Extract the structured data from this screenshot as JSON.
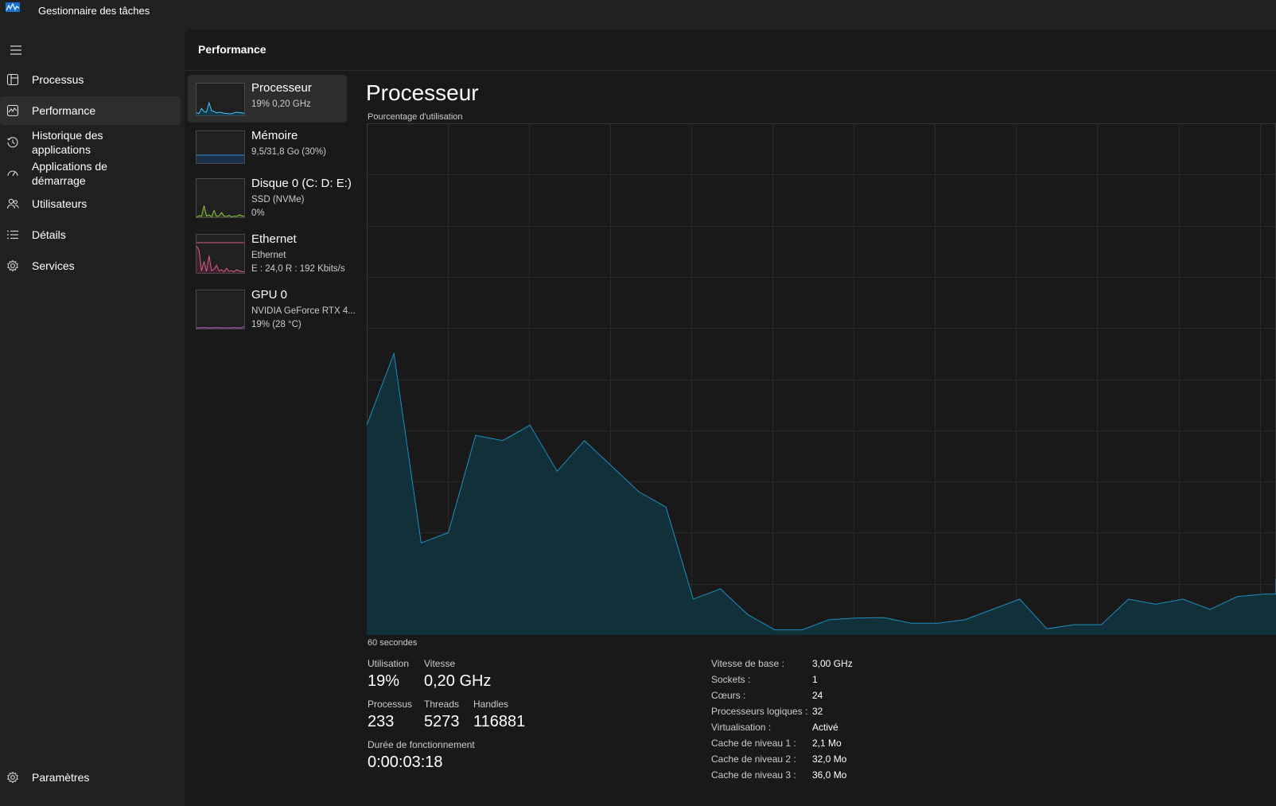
{
  "window": {
    "title": "Gestionnaire des tâches"
  },
  "nav": {
    "items": [
      {
        "label": "Processus",
        "icon": "processes-icon"
      },
      {
        "label": "Performance",
        "icon": "performance-icon",
        "active": true
      },
      {
        "label": "Historique des applications",
        "icon": "history-icon"
      },
      {
        "label": "Applications de démarrage",
        "icon": "startup-icon"
      },
      {
        "label": "Utilisateurs",
        "icon": "users-icon"
      },
      {
        "label": "Détails",
        "icon": "details-icon"
      },
      {
        "label": "Services",
        "icon": "services-icon"
      }
    ],
    "settings": {
      "label": "Paramètres",
      "icon": "gear-icon"
    }
  },
  "header": {
    "title": "Performance"
  },
  "devices": [
    {
      "name": "Processeur",
      "line1": "19%  0,20 GHz",
      "line2": "",
      "color": "#4cc2ff",
      "fill": "#0e3a4a",
      "active": true
    },
    {
      "name": "Mémoire",
      "line1": "9,5/31,8 Go (30%)",
      "line2": "",
      "color": "#3a8fd8",
      "fill": "#1b2f48"
    },
    {
      "name": "Disque 0 (C: D: E:)",
      "line1": "SSD (NVMe)",
      "line2": "0%",
      "color": "#8ac43f",
      "fill": "#2c3a1d"
    },
    {
      "name": "Ethernet",
      "line1": "Ethernet",
      "line2": "E : 24,0  R : 192 Kbits/s",
      "color": "#d65c8e",
      "fill": "#40222e"
    },
    {
      "name": "GPU 0",
      "line1": "NVIDIA GeForce RTX 4...",
      "line2": "19%  (28 °C)",
      "color": "#b25cc9",
      "fill": "#34213d"
    }
  ],
  "detail": {
    "title": "Processeur",
    "graph_label": "Pourcentage d'utilisation",
    "time_label": "60 secondes",
    "graph_color": "#1b8fbf",
    "graph_fill": "#12303a",
    "usage_percent": [
      41,
      55,
      18,
      20,
      39,
      38,
      41,
      32,
      38,
      33,
      28,
      25,
      7,
      9,
      4,
      1,
      1,
      3,
      3.3,
      3.4,
      2.3,
      2.3,
      3,
      5,
      7,
      1.2,
      2,
      2,
      7,
      6,
      7,
      5,
      7.5,
      8,
      8,
      8,
      9,
      9,
      10,
      11
    ]
  },
  "stats": {
    "utilisation": {
      "label": "Utilisation",
      "value": "19%"
    },
    "vitesse": {
      "label": "Vitesse",
      "value": "0,20 GHz"
    },
    "processus": {
      "label": "Processus",
      "value": "233"
    },
    "threads": {
      "label": "Threads",
      "value": "5273"
    },
    "handles": {
      "label": "Handles",
      "value": "116881"
    },
    "uptime": {
      "label": "Durée de fonctionnement",
      "value": "0:00:03:18"
    }
  },
  "specs": [
    {
      "key": "Vitesse de base :",
      "value": "3,00 GHz"
    },
    {
      "key": "Sockets :",
      "value": "1"
    },
    {
      "key": "Cœurs :",
      "value": "24"
    },
    {
      "key": "Processeurs logiques :",
      "value": "32"
    },
    {
      "key": "Virtualisation :",
      "value": "Activé"
    },
    {
      "key": "Cache de niveau 1 :",
      "value": "2,1 Mo"
    },
    {
      "key": "Cache de niveau 2 :",
      "value": "32,0 Mo"
    },
    {
      "key": "Cache de niveau 3 :",
      "value": "36,0 Mo"
    }
  ]
}
